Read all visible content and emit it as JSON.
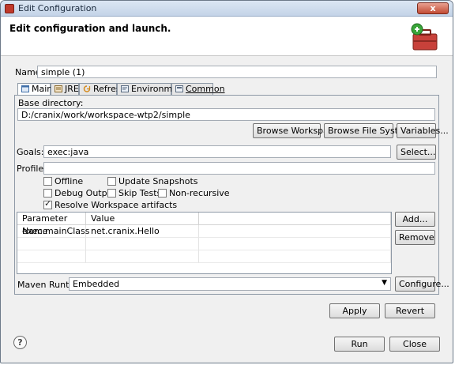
{
  "window": {
    "title": "Edit Configuration",
    "close_label": "x"
  },
  "header": {
    "title": "Edit configuration and launch."
  },
  "name": {
    "label": "Name:",
    "value": "simple (1)"
  },
  "tabs": [
    {
      "label": "Main",
      "icon": "main-icon"
    },
    {
      "label": "JRE",
      "icon": "jre-icon"
    },
    {
      "label": "Refresh",
      "icon": "refresh-icon"
    },
    {
      "label": "Environment",
      "icon": "environment-icon"
    },
    {
      "label": "Common",
      "icon": "common-icon"
    }
  ],
  "main": {
    "base_directory_label": "Base directory:",
    "base_directory_value": "D:/cranix/work/workspace-wtp2/simple",
    "browse_workspace": "Browse Workspace...",
    "browse_file_system": "Browse File System...",
    "variables": "Variables...",
    "goals_label": "Goals:",
    "goals_value": "exec:java",
    "select": "Select...",
    "profiles_label": "Profiles:",
    "profiles_value": "",
    "options": {
      "offline": {
        "label": "Offline",
        "checked": false
      },
      "update_snapshots": {
        "label": "Update Snapshots",
        "checked": false
      },
      "debug_output": {
        "label": "Debug Output",
        "checked": false
      },
      "skip_tests": {
        "label": "Skip Tests",
        "checked": false
      },
      "non_recursive": {
        "label": "Non-recursive",
        "checked": false
      },
      "resolve_workspace": {
        "label": "Resolve Workspace artifacts",
        "checked": true
      }
    },
    "params_table": {
      "columns": [
        "Parameter Name",
        "Value"
      ],
      "rows": [
        {
          "name": "exec.mainClass",
          "value": "net.cranix.Hello"
        }
      ]
    },
    "add": "Add...",
    "remove": "Remove",
    "maven_runtime_label": "Maven Runtime:",
    "maven_runtime_value": "Embedded",
    "configure": "Configure..."
  },
  "buttons": {
    "apply": "Apply",
    "revert": "Revert",
    "run": "Run",
    "close": "Close"
  },
  "help": "?",
  "colors": {
    "accent": "#c0392b",
    "title_bar": "#c4d4e8",
    "window_bg": "#f0f0f0"
  }
}
